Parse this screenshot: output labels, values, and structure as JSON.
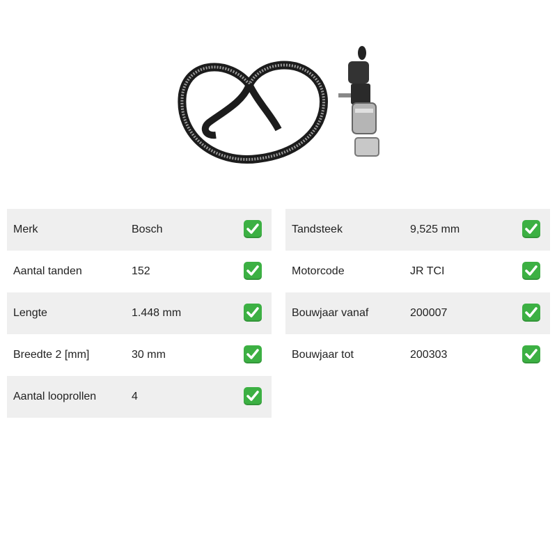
{
  "product": {
    "image_icon": "timing-belt-kit-image"
  },
  "specs_left": [
    {
      "label": "Merk",
      "value": "Bosch",
      "check_icon": "check-mark-icon"
    },
    {
      "label": "Aantal tanden",
      "value": "152",
      "check_icon": "check-mark-icon"
    },
    {
      "label": "Lengte",
      "value": "1.448 mm",
      "check_icon": "check-mark-icon"
    },
    {
      "label": "Breedte 2 [mm]",
      "value": "30 mm",
      "check_icon": "check-mark-icon"
    },
    {
      "label": "Aantal looprollen",
      "value": "4",
      "check_icon": "check-mark-icon"
    }
  ],
  "specs_right": [
    {
      "label": "Tandsteek",
      "value": "9,525 mm",
      "check_icon": "check-mark-icon"
    },
    {
      "label": "Motorcode",
      "value": "JR TCI",
      "check_icon": "check-mark-icon"
    },
    {
      "label": "Bouwjaar vanaf",
      "value": "200007",
      "check_icon": "check-mark-icon"
    },
    {
      "label": "Bouwjaar tot",
      "value": "200303",
      "check_icon": "check-mark-icon"
    }
  ],
  "colors": {
    "row_shade": "#efefef",
    "check_green": "#3cb043"
  }
}
